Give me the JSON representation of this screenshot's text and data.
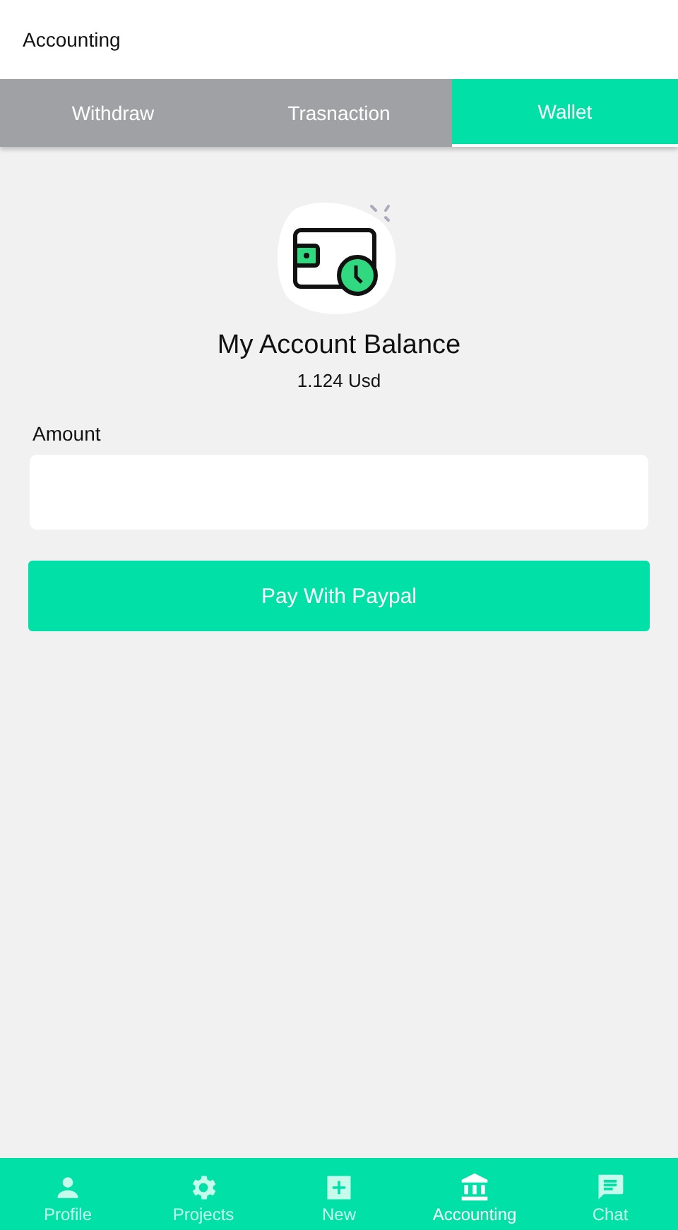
{
  "app_bar": {
    "title": "Accounting"
  },
  "tabs": [
    {
      "label": "Withdraw",
      "selected": false
    },
    {
      "label": "Trasnaction",
      "selected": false
    },
    {
      "label": "Wallet",
      "selected": true
    }
  ],
  "balance": {
    "title": "My Account Balance",
    "amount": "1.124 Usd"
  },
  "form": {
    "label": "Amount",
    "button": "Pay With Paypal"
  },
  "bottom_nav": [
    {
      "label": "Profile",
      "kind": "person",
      "selected": false
    },
    {
      "label": "Projects",
      "kind": "gear",
      "selected": false
    },
    {
      "label": "New",
      "kind": "plus",
      "selected": false
    },
    {
      "label": "Accounting",
      "kind": "bank",
      "selected": true
    },
    {
      "label": "Chat",
      "kind": "chat",
      "selected": false
    }
  ]
}
